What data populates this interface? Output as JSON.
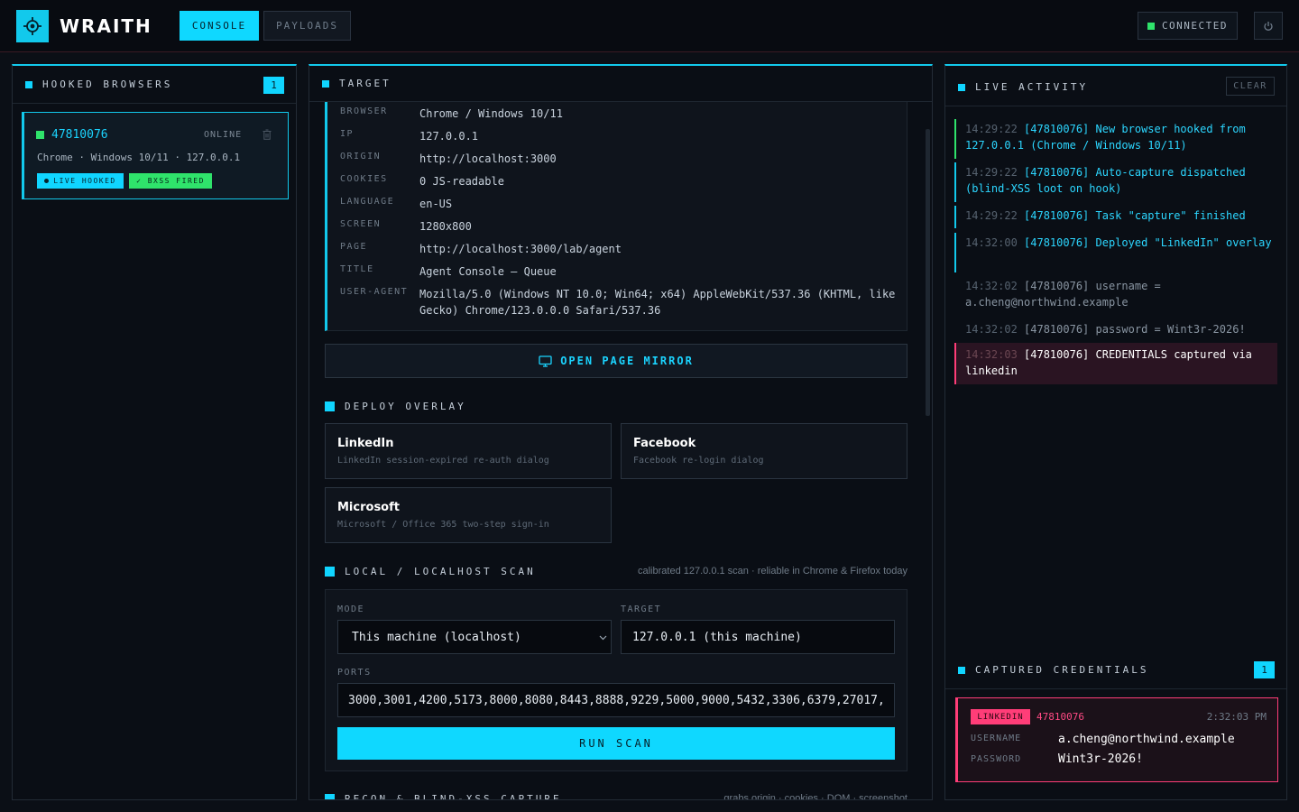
{
  "app": {
    "brand": "WRAITH",
    "nav": [
      {
        "label": "CONSOLE",
        "active": true
      },
      {
        "label": "PAYLOADS",
        "active": false
      }
    ],
    "status": "CONNECTED"
  },
  "colors": {
    "accent": "#10d5ff",
    "success": "#2fe36b",
    "danger": "#ff3d78"
  },
  "hooked": {
    "title": "HOOKED BROWSERS",
    "count": "1",
    "items": [
      {
        "id": "47810076",
        "state": "ONLINE",
        "sub": "Chrome · Windows 10/11 · 127.0.0.1",
        "tag_live": "LIVE HOOKED",
        "tag_bxss": "✓ BXSS FIRED"
      }
    ]
  },
  "target": {
    "title": "TARGET",
    "rows": [
      {
        "k": "BROWSER",
        "v": "Chrome / Windows 10/11"
      },
      {
        "k": "IP",
        "v": "127.0.0.1"
      },
      {
        "k": "ORIGIN",
        "v": "http://localhost:3000"
      },
      {
        "k": "COOKIES",
        "v": "0 JS-readable"
      },
      {
        "k": "LANGUAGE",
        "v": "en-US"
      },
      {
        "k": "SCREEN",
        "v": "1280x800"
      },
      {
        "k": "PAGE",
        "v": "http://localhost:3000/lab/agent"
      },
      {
        "k": "TITLE",
        "v": "Agent Console — Queue"
      },
      {
        "k": "USER-AGENT",
        "v": "Mozilla/5.0 (Windows NT 10.0; Win64; x64) AppleWebKit/537.36 (KHTML, like Gecko) Chrome/123.0.0.0 Safari/537.36"
      }
    ],
    "mirror_label": "OPEN PAGE MIRROR"
  },
  "overlay": {
    "title": "DEPLOY OVERLAY",
    "cards": [
      {
        "title": "LinkedIn",
        "desc": "LinkedIn session-expired re-auth dialog"
      },
      {
        "title": "Facebook",
        "desc": "Facebook re-login dialog"
      },
      {
        "title": "Microsoft",
        "desc": "Microsoft / Office 365 two-step sign-in"
      }
    ]
  },
  "scan": {
    "title": "LOCAL / LOCALHOST SCAN",
    "note": "calibrated 127.0.0.1 scan · reliable in Chrome & Firefox today",
    "mode_label": "MODE",
    "mode_value": "This machine (localhost)",
    "target_label": "TARGET",
    "target_value": "127.0.0.1 (this machine)",
    "ports_label": "PORTS",
    "ports_value": "3000,3001,4200,5173,8000,8080,8443,8888,9229,5000,9000,5432,3306,6379,27017,",
    "run_label": "RUN SCAN"
  },
  "recon": {
    "title": "RECON & BLIND-XSS CAPTURE",
    "note": "grabs origin · cookies · DOM · screenshot"
  },
  "activity": {
    "title": "LIVE ACTIVITY",
    "clear_label": "CLEAR",
    "logs": [
      {
        "time": "14:29:22",
        "msg": "[47810076] New browser hooked from 127.0.0.1 (Chrome / Windows 10/11)",
        "kind": "green"
      },
      {
        "time": "14:29:22",
        "msg": "[47810076] Auto-capture dispatched (blind-XSS loot on hook)",
        "kind": "cyan"
      },
      {
        "time": "14:29:22",
        "msg": "[47810076] Task \"capture\" finished",
        "kind": "cyan"
      },
      {
        "time": "14:32:00",
        "msg": "[47810076] Deployed \"LinkedIn\" overlay",
        "kind": "cyan"
      },
      {
        "time": "14:32:02",
        "msg": "[47810076] username = a.cheng@northwind.example",
        "kind": "gray"
      },
      {
        "time": "14:32:02",
        "msg": "[47810076] password = Wint3r-2026!",
        "kind": "gray"
      },
      {
        "time": "14:32:03",
        "msg": "[47810076] CREDENTIALS captured via linkedin",
        "kind": "red"
      }
    ]
  },
  "credentials": {
    "title": "CAPTURED CREDENTIALS",
    "count": "1",
    "items": [
      {
        "source": "LINKEDIN",
        "id": "47810076",
        "time": "2:32:03 PM",
        "username_label": "USERNAME",
        "username": "a.cheng@northwind.example",
        "password_label": "PASSWORD",
        "password": "Wint3r-2026!"
      }
    ]
  }
}
